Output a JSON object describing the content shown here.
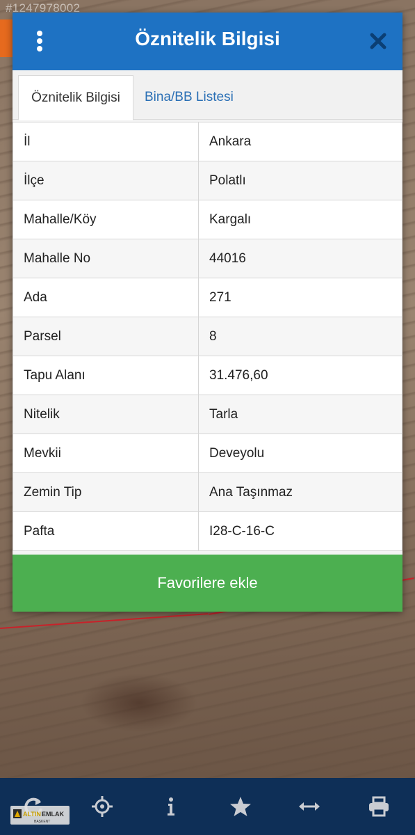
{
  "watermark_id": "#1247978002",
  "dialog": {
    "title": "Öznitelik Bilgisi",
    "menu_icon": "vertical-dots-icon",
    "close_icon": "close-icon"
  },
  "tabs": [
    {
      "label": "Öznitelik Bilgisi",
      "active": true
    },
    {
      "label": "Bina/BB Listesi",
      "active": false
    }
  ],
  "attributes": [
    {
      "key": "İl",
      "value": "Ankara"
    },
    {
      "key": "İlçe",
      "value": "Polatlı"
    },
    {
      "key": "Mahalle/Köy",
      "value": "Kargalı"
    },
    {
      "key": "Mahalle No",
      "value": "44016"
    },
    {
      "key": "Ada",
      "value": "271"
    },
    {
      "key": "Parsel",
      "value": "8"
    },
    {
      "key": "Tapu Alanı",
      "value": "31.476,60"
    },
    {
      "key": "Nitelik",
      "value": "Tarla"
    },
    {
      "key": "Mevkii",
      "value": "Deveyolu"
    },
    {
      "key": "Zemin Tip",
      "value": "Ana Taşınmaz"
    },
    {
      "key": "Pafta",
      "value": "I28-C-16-C"
    }
  ],
  "favorite_button": "Favorilere ekle",
  "bottom_bar": {
    "icons": [
      "refresh-icon",
      "crosshair-icon",
      "info-icon",
      "star-icon",
      "measure-icon",
      "print-icon"
    ]
  },
  "logo": {
    "brand": "ALTIN EMLAK",
    "sub": "BAŞKENT"
  },
  "colors": {
    "header": "#1e72c3",
    "tab_link": "#2a6fb5",
    "button": "#4caf50",
    "bottom_bar": "#0e2f57"
  }
}
